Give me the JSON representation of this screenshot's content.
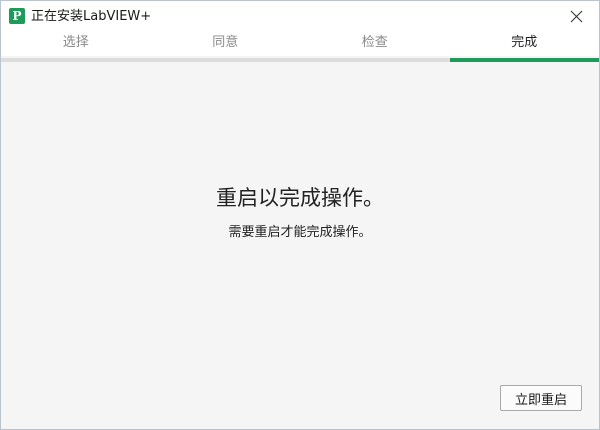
{
  "window": {
    "title": "正在安装LabVIEW+",
    "app_icon_letter": "P",
    "app_icon_color": "#1e9a5a"
  },
  "tabs": [
    {
      "label": "选择",
      "active": false
    },
    {
      "label": "同意",
      "active": false
    },
    {
      "label": "检查",
      "active": false
    },
    {
      "label": "完成",
      "active": true
    }
  ],
  "progress": {
    "current_step": 4,
    "total_steps": 4,
    "accent_color": "#1e9a5a"
  },
  "main": {
    "heading": "重启以完成操作。",
    "subtext": "需要重启才能完成操作。"
  },
  "footer": {
    "restart_button": "立即重启"
  },
  "icons": {
    "close": "close-icon",
    "app": "app-icon"
  }
}
